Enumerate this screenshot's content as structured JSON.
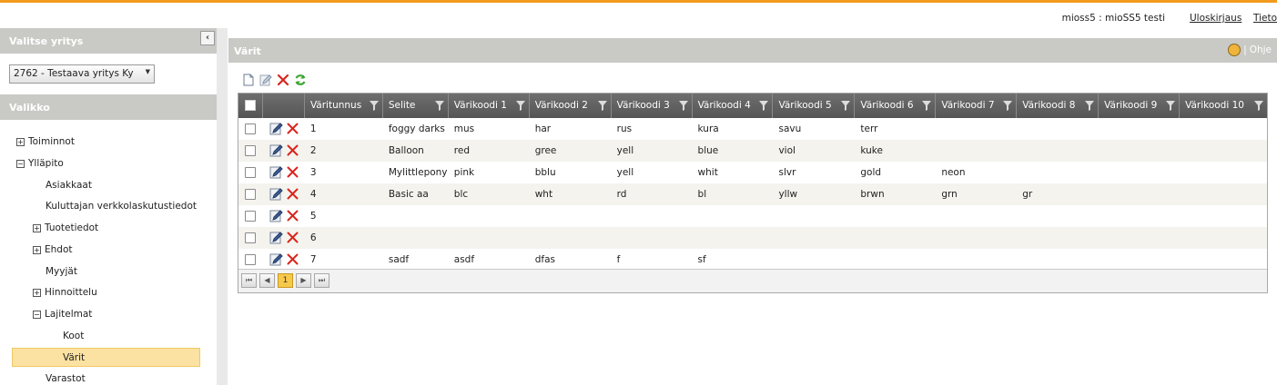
{
  "header": {
    "user_info": "mioss5 : mioSS5 testi",
    "logout_label": "Uloskirjaus",
    "info_label": "Tieto"
  },
  "sidebar": {
    "company_title": "Valitse yritys",
    "collapse_glyph": "‹",
    "company_selected": "2762 - Testaava yritys Ky",
    "menu_title": "Valikko",
    "items": [
      {
        "label": "Toiminnot",
        "toggle": "+"
      },
      {
        "label": "Ylläpito",
        "toggle": "−"
      },
      {
        "label": "Asiakkaat"
      },
      {
        "label": "Kuluttajan verkkolaskutustiedot"
      },
      {
        "label": "Tuotetiedot",
        "toggle": "+"
      },
      {
        "label": "Ehdot",
        "toggle": "+"
      },
      {
        "label": "Myyjät"
      },
      {
        "label": "Hinnoittelu",
        "toggle": "+"
      },
      {
        "label": "Lajitelmat",
        "toggle": "−"
      },
      {
        "label": "Koot"
      },
      {
        "label": "Värit"
      },
      {
        "label": "Varastot"
      }
    ]
  },
  "panel": {
    "title": "Värit",
    "help_label": "Ohje"
  },
  "grid": {
    "columns": [
      "Väritunnus",
      "Selite",
      "Värikoodi 1",
      "Värikoodi 2",
      "Värikoodi 3",
      "Värikoodi 4",
      "Värikoodi 5",
      "Värikoodi 6",
      "Värikoodi 7",
      "Värikoodi 8",
      "Värikoodi 9",
      "Värikoodi 10"
    ],
    "rows": [
      [
        "1",
        "foggy darks",
        "mus",
        "har",
        "rus",
        "kura",
        "savu",
        "terr",
        "",
        "",
        "",
        ""
      ],
      [
        "2",
        "Balloon",
        "red",
        "gree",
        "yell",
        "blue",
        "viol",
        "kuke",
        "",
        "",
        "",
        ""
      ],
      [
        "3",
        "Mylittlepony",
        "pink",
        "bblu",
        "yell",
        "whit",
        "slvr",
        "gold",
        "neon",
        "",
        "",
        ""
      ],
      [
        "4",
        "Basic aa",
        "blc",
        "wht",
        "rd",
        "bl",
        "yllw",
        "brwn",
        "grn",
        "gr",
        "",
        ""
      ],
      [
        "5",
        "",
        "",
        "",
        "",
        "",
        "",
        "",
        "",
        "",
        "",
        ""
      ],
      [
        "6",
        "",
        "",
        "",
        "",
        "",
        "",
        "",
        "",
        "",
        "",
        ""
      ],
      [
        "7",
        "sadf",
        "asdf",
        "dfas",
        "f",
        "sf",
        "",
        "",
        "",
        "",
        "",
        ""
      ]
    ]
  },
  "pager": {
    "first": "⏮",
    "prev": "◀",
    "current_page": "1",
    "next": "▶",
    "last": "⏭"
  },
  "colors": {
    "accent": "#f29a1d",
    "header_gray": "#c9c9c5",
    "selected_bg": "#fbe2a2",
    "delete_red": "#d9251c",
    "refresh_green": "#3aa630"
  }
}
